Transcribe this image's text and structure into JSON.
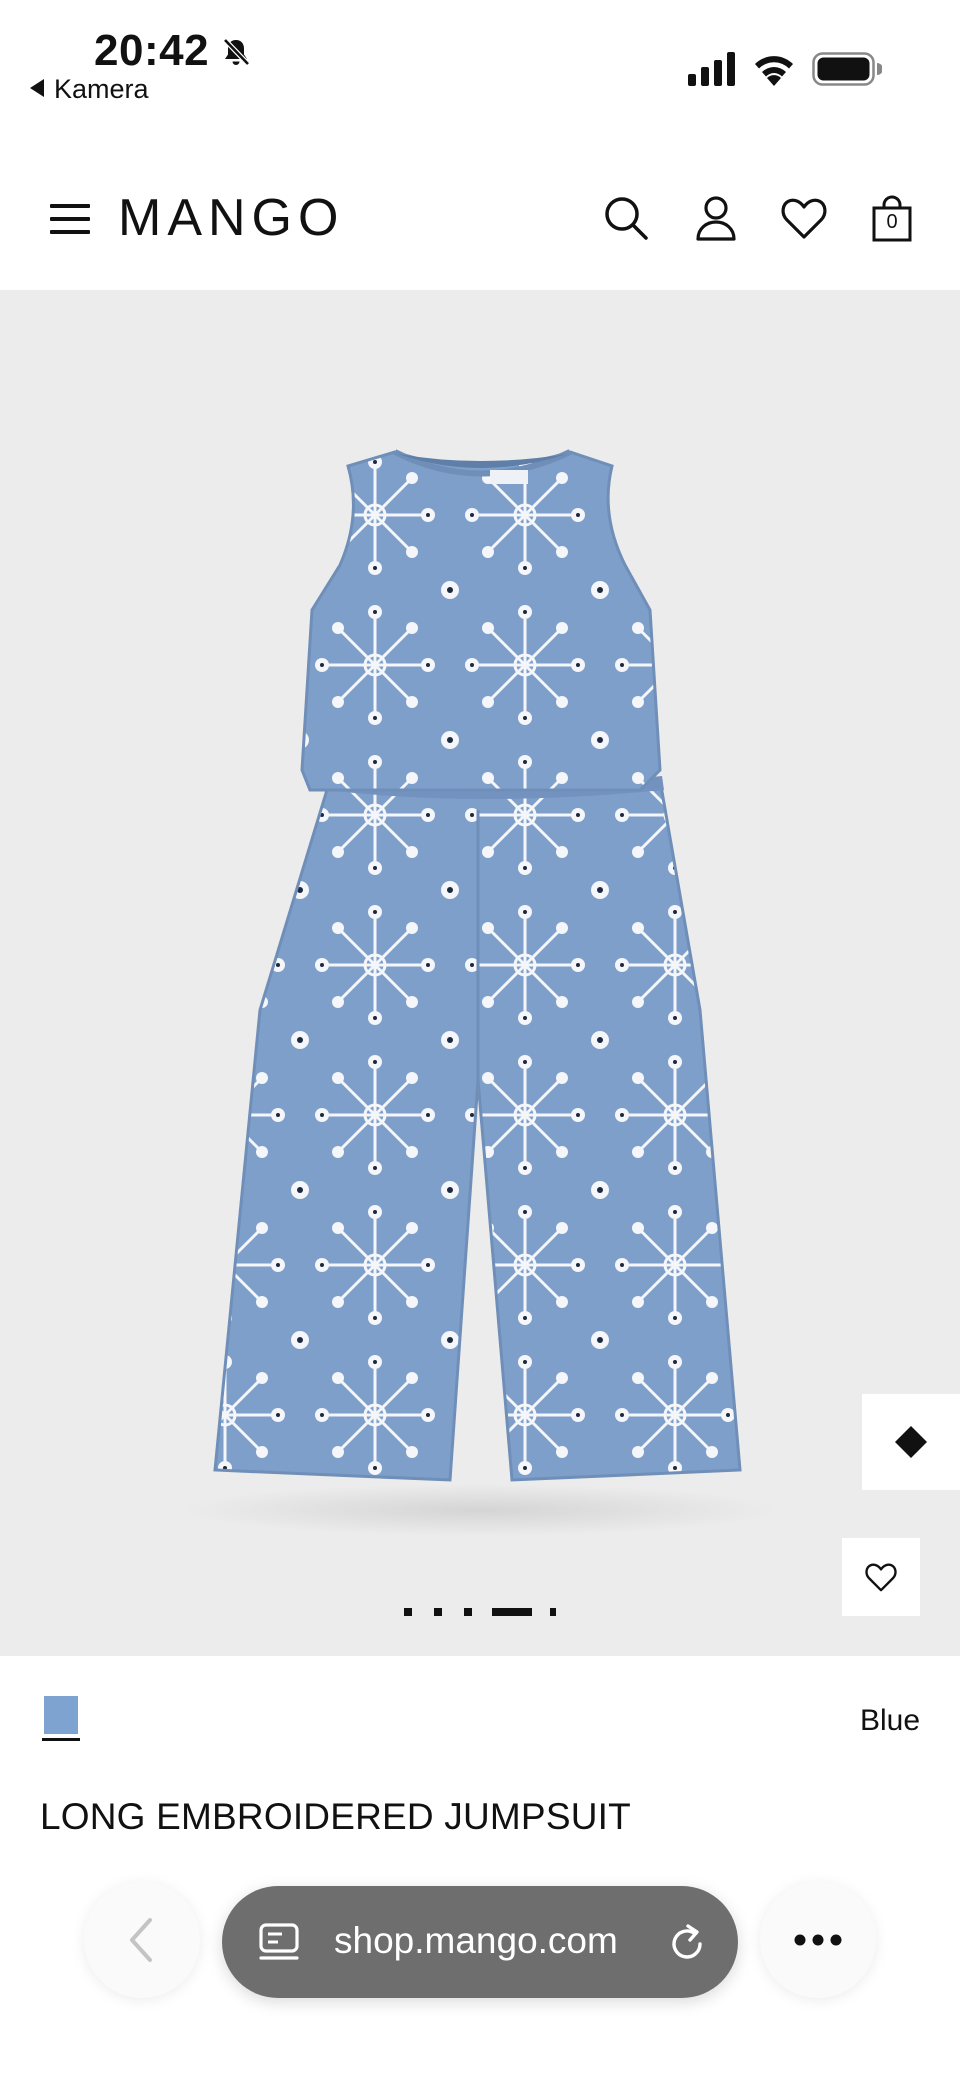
{
  "status": {
    "time": "20:42",
    "back_app": "Kamera"
  },
  "header": {
    "logo": "MANGO",
    "cart_count": "0"
  },
  "gallery": {
    "image_count": 5,
    "active_index": 3
  },
  "product": {
    "color_name": "Blue",
    "swatch_color": "#7fa3d1",
    "title": "LONG EMBROIDERED JUMPSUIT"
  },
  "browser": {
    "url": "shop.mango.com"
  },
  "colors": {
    "fabric": "#7e9fc9",
    "fabric_dark": "#6f8fb9",
    "embroidery": "#f4f6fa",
    "gallery_bg": "#ececec",
    "url_pill": "#6e6e6e"
  }
}
